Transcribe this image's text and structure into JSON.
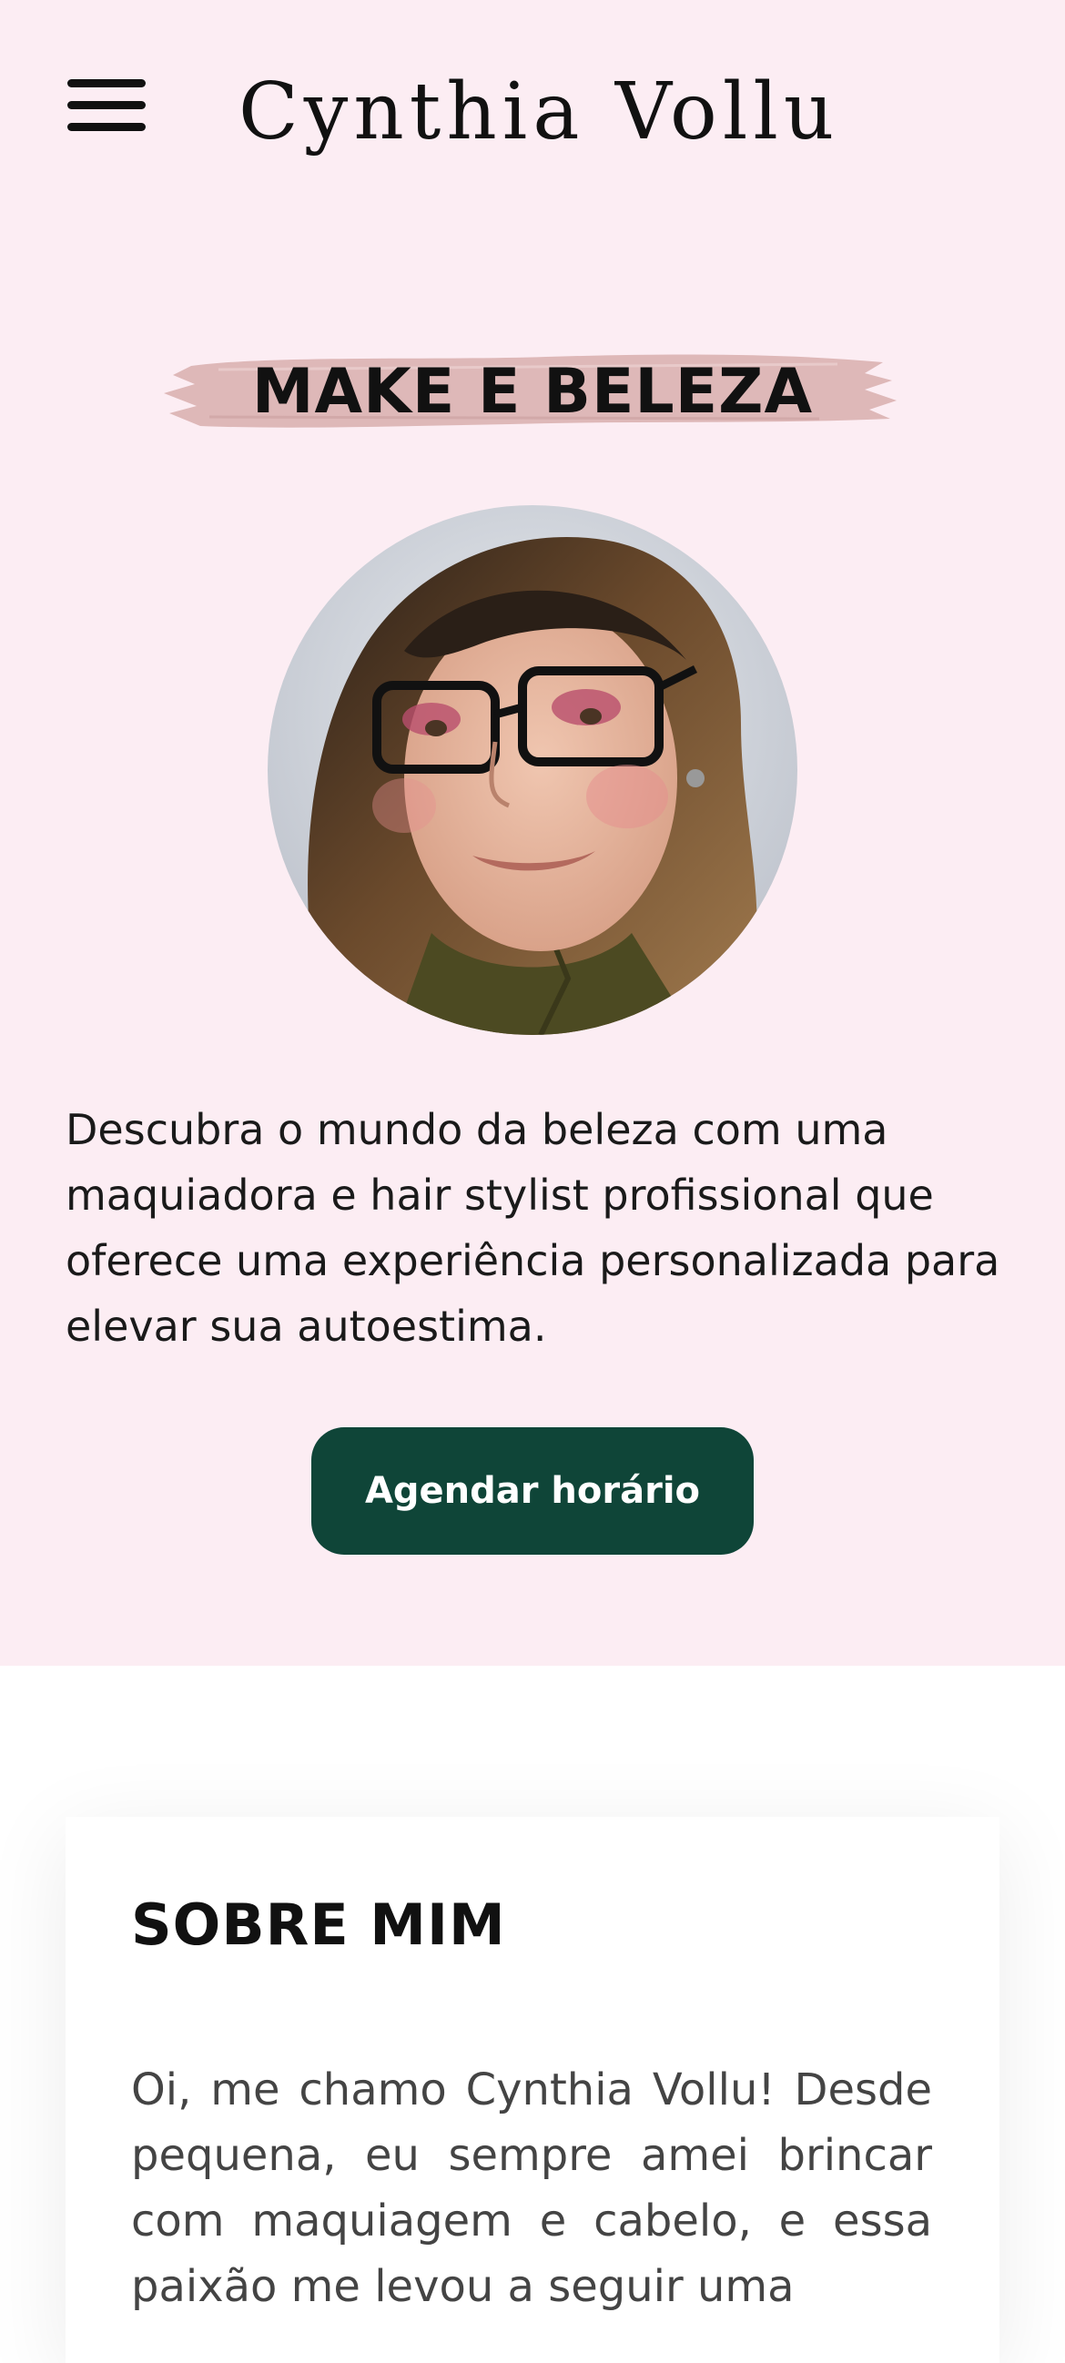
{
  "header": {
    "menu_icon": "hamburger-menu-icon",
    "brand": "Cynthia Vollu"
  },
  "hero": {
    "tagline": "MAKE E BELEZA",
    "portrait_alt": "Portrait photo",
    "intro": "Descubra o mundo da beleza com uma maquiadora e hair stylist profissional que oferece uma experiência personalizada para elevar sua autoestima.",
    "cta_label": "Agendar horário"
  },
  "about": {
    "title": "SOBRE MIM",
    "text": "Oi, me chamo Cynthia Vollu! Desde pequena, eu sempre amei brincar com maquiagem e cabelo, e essa paixão me levou a seguir uma"
  },
  "colors": {
    "hero_bg": "#fcedf3",
    "brush_stroke": "#deb8b8",
    "cta_bg": "#0f4538",
    "cta_text": "#ffffff"
  }
}
